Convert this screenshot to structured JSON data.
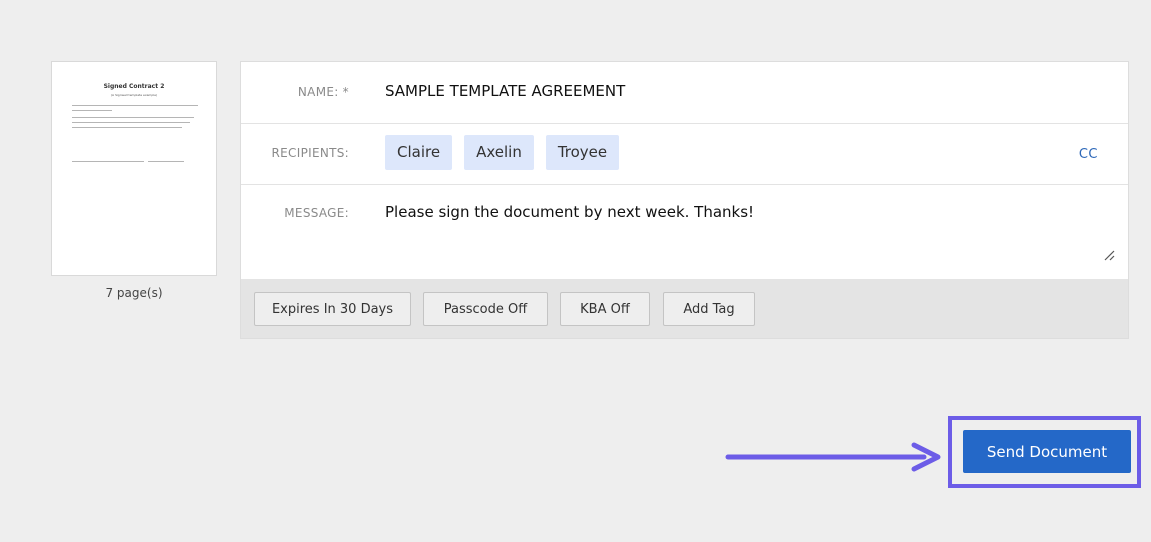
{
  "thumbnail": {
    "title": "Signed Contract 2",
    "subtitle": "(A Signwell template example)",
    "page_count": "7 page(s)"
  },
  "form": {
    "name": {
      "label": "NAME: *",
      "value": "SAMPLE TEMPLATE AGREEMENT"
    },
    "recipients": {
      "label": "RECIPIENTS:",
      "chips": [
        "Claire",
        "Axelin",
        "Troyee"
      ],
      "cc_label": "CC"
    },
    "message": {
      "label": "MESSAGE:",
      "value": "Please sign the document by next week. Thanks!"
    },
    "options": {
      "expires": "Expires In 30 Days",
      "passcode": "Passcode Off",
      "kba": "KBA Off",
      "add_tag": "Add Tag"
    }
  },
  "send": {
    "label": "Send Document"
  },
  "colors": {
    "accent": "#2468c8",
    "highlight": "#6c5ce7",
    "chip_background": "#dde7fb",
    "link": "#2c67b8"
  }
}
